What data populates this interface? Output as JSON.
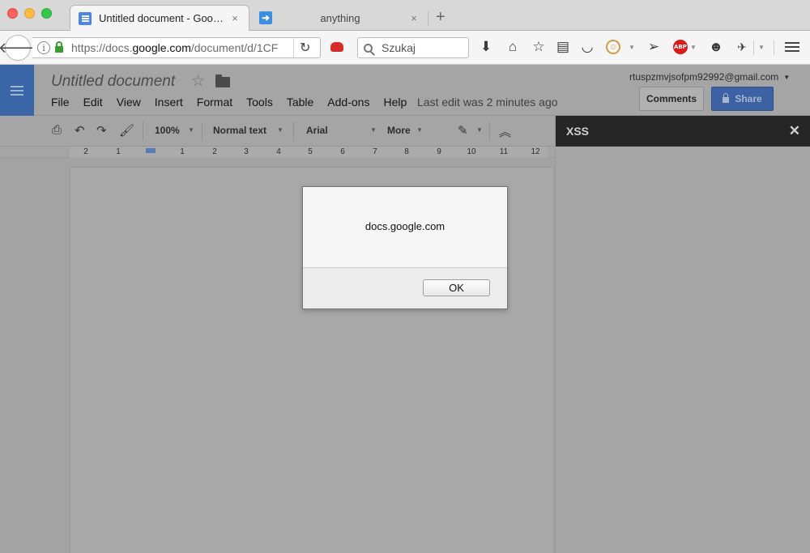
{
  "browser": {
    "tabs": [
      {
        "title": "Untitled document - Google…",
        "active": true
      },
      {
        "title": "anything",
        "active": false
      }
    ],
    "new_tab_label": "+",
    "tab_close_glyph": "×",
    "url": {
      "prefix": "https://docs.",
      "domain": "google.com",
      "path": "/document/d/1CF"
    },
    "search_placeholder": "Szukaj",
    "abp_label": "ABP"
  },
  "docs": {
    "title": "Untitled document",
    "menu": [
      "File",
      "Edit",
      "View",
      "Insert",
      "Format",
      "Tools",
      "Table",
      "Add-ons",
      "Help"
    ],
    "last_edit": "Last edit was 2 minutes ago",
    "account": "rtuspzmvjsofpm92992@gmail.com",
    "comments_label": "Comments",
    "share_label": "Share",
    "toolbar": {
      "zoom": "100%",
      "style": "Normal text",
      "font": "Arial",
      "more": "More"
    },
    "ruler_numbers": [
      "2",
      "1",
      "1",
      "2",
      "3",
      "4",
      "5",
      "6",
      "7",
      "8",
      "9",
      "10",
      "11",
      "12"
    ]
  },
  "side_panel": {
    "title": "XSS",
    "close_glyph": "✕"
  },
  "dialog": {
    "message": "docs.google.com",
    "ok_label": "OK"
  },
  "colors": {
    "docs_blue": "#4a86e8",
    "share_blue": "#3d62a4",
    "panel_header": "#262626"
  }
}
